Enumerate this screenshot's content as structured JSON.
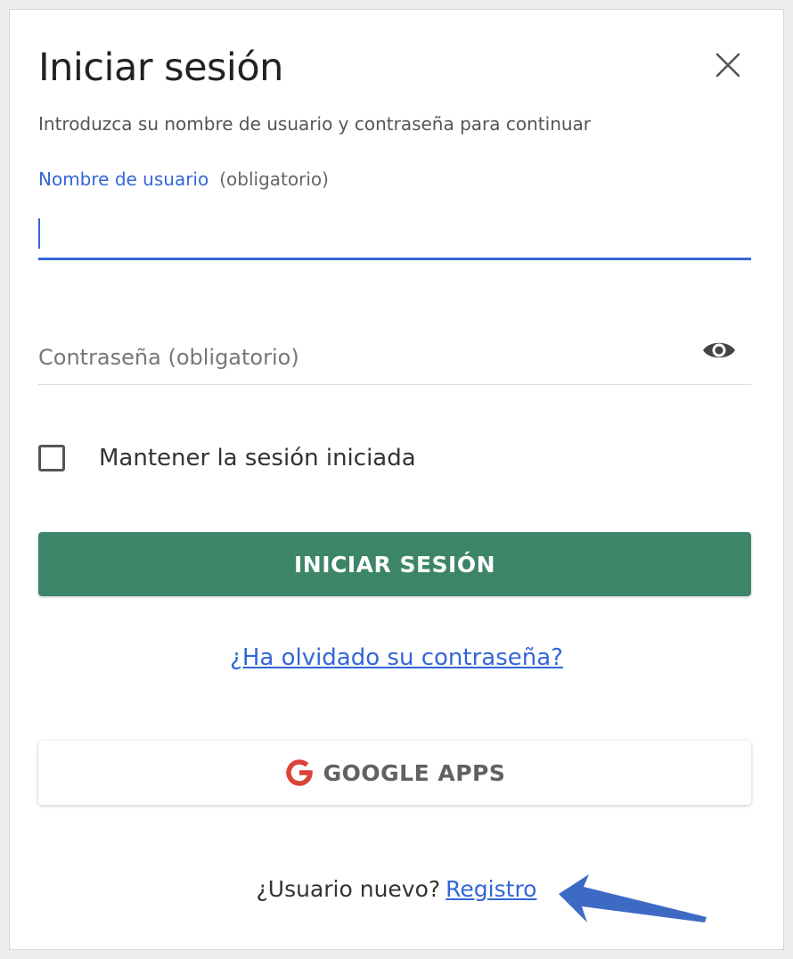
{
  "dialog": {
    "title": "Iniciar sesión",
    "subtitle": "Introduzca su nombre de usuario y contraseña para continuar",
    "close_icon": "close-icon"
  },
  "username": {
    "label": "Nombre de usuario",
    "required": "(obligatorio)",
    "value": ""
  },
  "password": {
    "placeholder": "Contraseña (obligatorio)",
    "toggle_icon": "eye-icon"
  },
  "remember": {
    "label": "Mantener la sesión iniciada",
    "checked": false
  },
  "login_button": {
    "label": "INICIAR SESIÓN",
    "color": "#3d8568"
  },
  "forgot_link": {
    "label": "¿Ha olvidado su contraseña?"
  },
  "google_button": {
    "label": "GOOGLE APPS",
    "icon": "google-g-icon",
    "icon_color": "#db4437"
  },
  "register": {
    "prompt": "¿Usuario nuevo?",
    "link_label": "Registro"
  },
  "colors": {
    "accent": "#3367d6",
    "arrow": "#3d6bc4"
  }
}
